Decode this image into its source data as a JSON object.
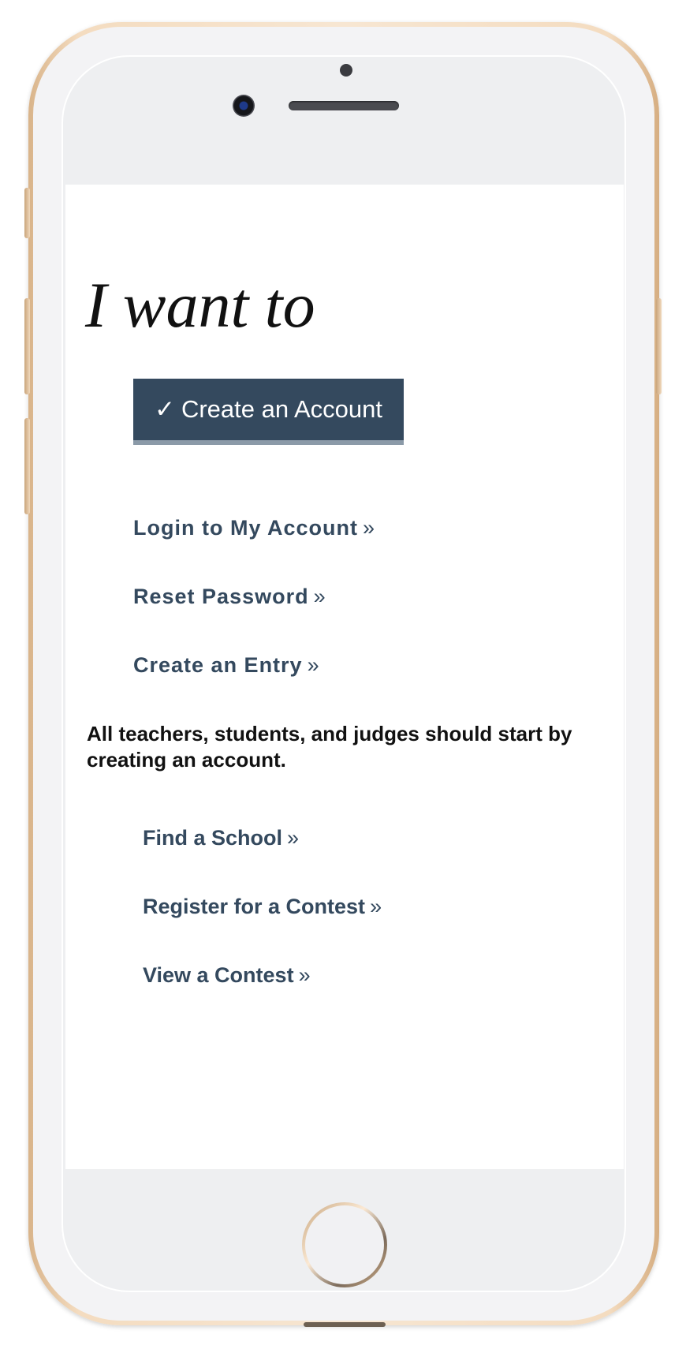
{
  "headline": "I want to",
  "primary_button": {
    "check": "✓",
    "label": "Create an Account"
  },
  "actions": [
    {
      "label": "Login to My Account",
      "arrow": "»"
    },
    {
      "label": "Reset Password",
      "arrow": "»"
    },
    {
      "label": "Create an Entry",
      "arrow": "»"
    }
  ],
  "note": "All teachers, students, and judges should start by creating an account.",
  "secondary_links": [
    {
      "label": "Find a School",
      "arrow": "»"
    },
    {
      "label": "Register for a Contest",
      "arrow": "»"
    },
    {
      "label": "View a Contest",
      "arrow": "»"
    }
  ],
  "colors": {
    "primary": "#34495e",
    "primary_border": "#8b9aa8",
    "text": "#111111",
    "phone_frame": "#e8c9a4"
  },
  "icons": {
    "check": "check-icon",
    "arrow": "double-chevron-right-icon"
  }
}
